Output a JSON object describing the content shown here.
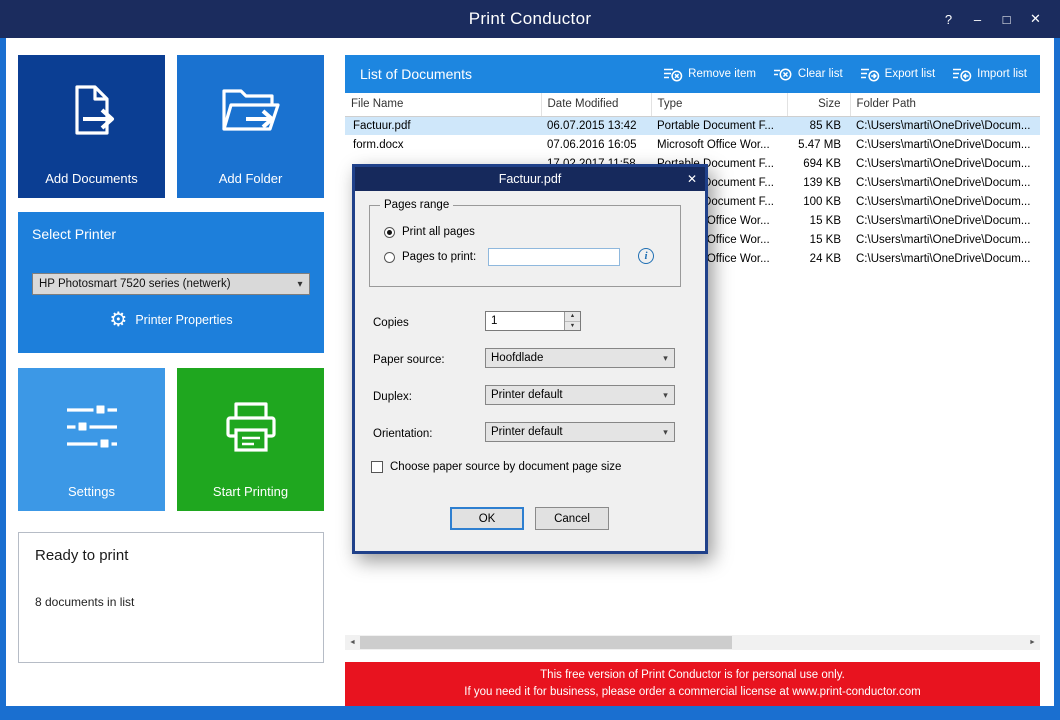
{
  "titlebar": {
    "title": "Print Conductor",
    "help": "?",
    "minimize": "–",
    "maximize": "□",
    "close": "✕"
  },
  "sidebar": {
    "add_documents": "Add Documents",
    "add_folder": "Add Folder",
    "select_printer": {
      "label": "Select Printer",
      "selected": "HP Photosmart 7520 series (netwerk)",
      "properties": "Printer Properties"
    },
    "settings": "Settings",
    "start_printing": "Start Printing",
    "status": {
      "line1": "Ready to print",
      "line2": "8 documents in list"
    }
  },
  "documents": {
    "title": "List of Documents",
    "actions": [
      {
        "label": "Remove item"
      },
      {
        "label": "Clear list"
      },
      {
        "label": "Export list"
      },
      {
        "label": "Import list"
      }
    ],
    "columns": [
      "File Name",
      "Date Modified",
      "Type",
      "Size",
      "Folder Path"
    ],
    "rows": [
      {
        "file": "Factuur.pdf",
        "date": "06.07.2015 13:42",
        "type": "Portable Document F...",
        "size": "85 KB",
        "path": "C:\\Users\\marti\\OneDrive\\Docum...",
        "selected": true
      },
      {
        "file": "form.docx",
        "date": "07.06.2016 16:05",
        "type": "Microsoft Office Wor...",
        "size": "5.47 MB",
        "path": "C:\\Users\\marti\\OneDrive\\Docum...",
        "selected": false
      },
      {
        "file": "",
        "date": "17.02.2017 11:58",
        "type": "Portable Document F...",
        "size": "694 KB",
        "path": "C:\\Users\\marti\\OneDrive\\Docum...",
        "selected": false
      },
      {
        "file": "",
        "date": "",
        "type": "Portable Document F...",
        "size": "139 KB",
        "path": "C:\\Users\\marti\\OneDrive\\Docum...",
        "selected": false
      },
      {
        "file": "",
        "date": "",
        "type": "Portable Document F...",
        "size": "100 KB",
        "path": "C:\\Users\\marti\\OneDrive\\Docum...",
        "selected": false
      },
      {
        "file": "",
        "date": "",
        "type": "Microsoft Office Wor...",
        "size": "15 KB",
        "path": "C:\\Users\\marti\\OneDrive\\Docum...",
        "selected": false
      },
      {
        "file": "",
        "date": "",
        "type": "Microsoft Office Wor...",
        "size": "15 KB",
        "path": "C:\\Users\\marti\\OneDrive\\Docum...",
        "selected": false
      },
      {
        "file": "",
        "date": "",
        "type": "Microsoft Office Wor...",
        "size": "24 KB",
        "path": "C:\\Users\\marti\\OneDrive\\Docum...",
        "selected": false
      }
    ]
  },
  "banner": {
    "line1": "This free version of Print Conductor is for personal use only.",
    "line2": "If you need it for business, please order a commercial license at www.print-conductor.com"
  },
  "dialog": {
    "title": "Factuur.pdf",
    "close": "✕",
    "pages_range": {
      "legend": "Pages range",
      "print_all": "Print all pages",
      "pages_to_print": "Pages to print:",
      "pages_value": ""
    },
    "copies": {
      "label": "Copies",
      "value": "1"
    },
    "paper_source": {
      "label": "Paper source:",
      "value": "Hoofdlade"
    },
    "duplex": {
      "label": "Duplex:",
      "value": "Printer default"
    },
    "orientation": {
      "label": "Orientation:",
      "value": "Printer default"
    },
    "checkbox_label": "Choose paper source by document page size",
    "ok": "OK",
    "cancel": "Cancel"
  },
  "icons": {
    "gear": "⚙",
    "dropdown_chevron": "▾",
    "info": "i",
    "spin_up": "▲",
    "spin_down": "▼",
    "scroll_left": "◄",
    "scroll_right": "►"
  },
  "colors": {
    "titlebar": "#1b2c5e",
    "frame_blue": "#1a6fd0",
    "dark_tile": "#0b3e93",
    "medium_tile": "#1a72d0",
    "panel_blue": "#1d7fdb",
    "light_tile": "#3c98e6",
    "green_tile": "#1fa71f",
    "list_header": "#1d86e0",
    "selection": "#cfe7fa",
    "banner_red": "#e8131f"
  }
}
